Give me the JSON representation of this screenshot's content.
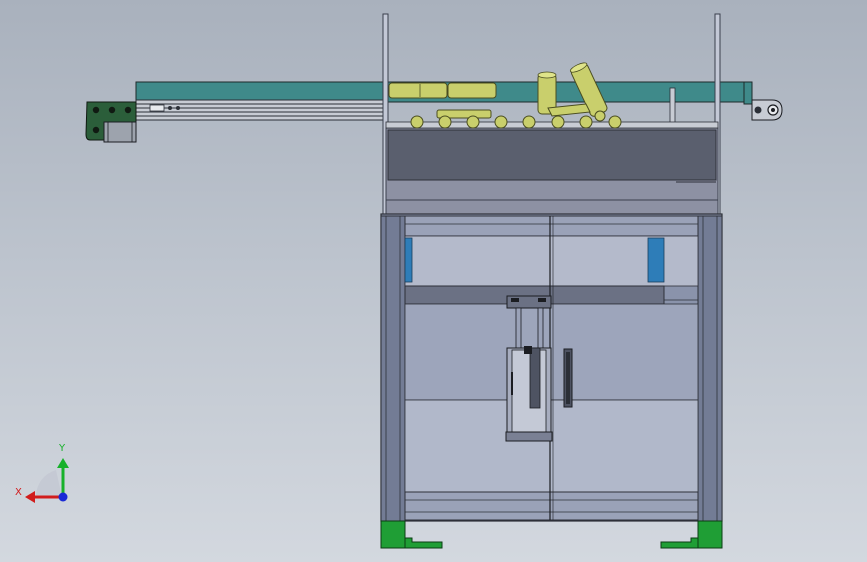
{
  "viewport": {
    "background_top": "#a9b1bd",
    "background_bottom": "#d3d8df"
  },
  "model": {
    "name": "conveyor-loading-machine",
    "colors": {
      "conveyor_belt": "#3f8a8a",
      "product": "#c9cf6c",
      "frame": "#8a93ab",
      "panel_dark": "#5a5f6e",
      "bracket": "#1f9e35",
      "motor_bracket": "#2b5e3a",
      "accent_blue": "#2e7db8"
    },
    "products_on_belt": 10
  },
  "triad": {
    "x_label": "X",
    "y_label": "Y",
    "x_color": "#d11c1c",
    "y_color": "#17b12a",
    "z_color": "#1a2ad6"
  }
}
